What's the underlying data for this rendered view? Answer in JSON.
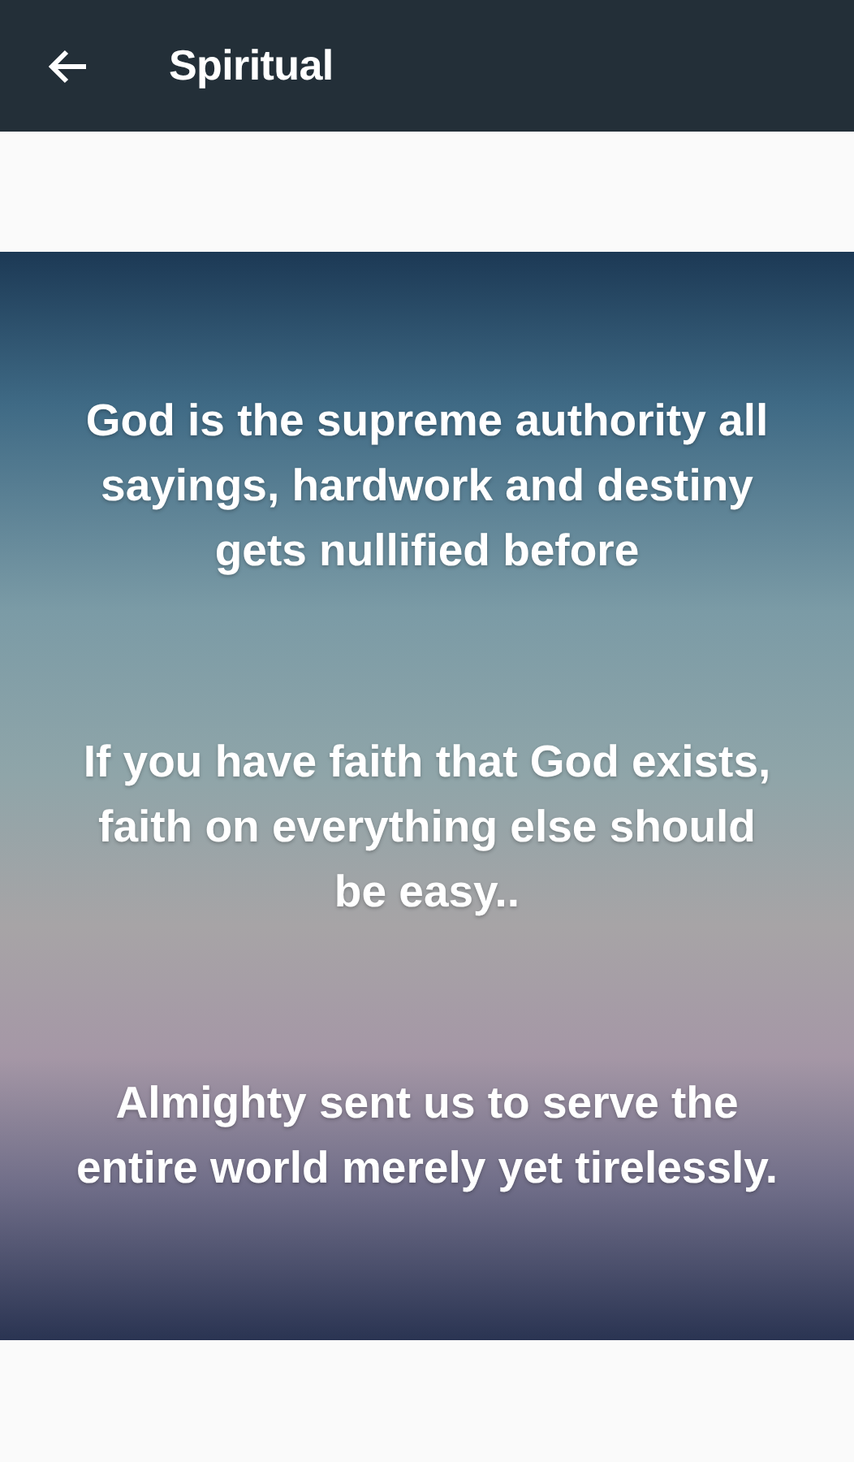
{
  "app_bar": {
    "title": "Spiritual"
  },
  "quotes": [
    {
      "text": "God is the supreme authority all sayings, hardwork and destiny gets nullified before"
    },
    {
      "text": "If you have faith that God exists, faith on everything else should be easy.."
    },
    {
      "text": "Almighty sent us to serve the entire world merely yet tirelessly."
    }
  ]
}
